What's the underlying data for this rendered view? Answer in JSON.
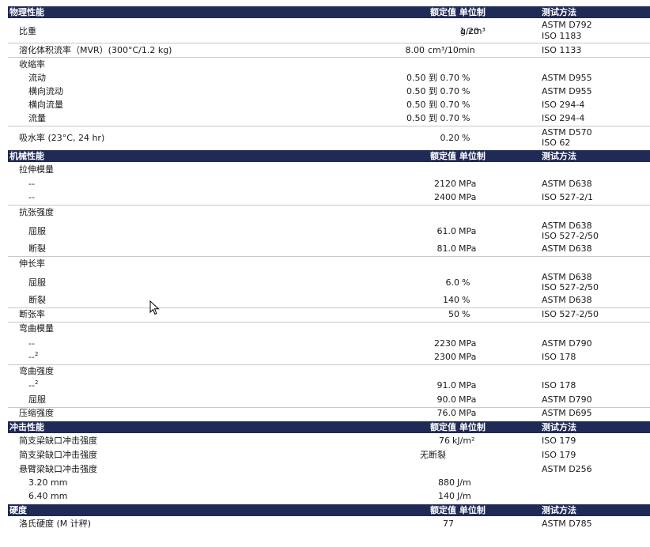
{
  "headers": {
    "value_unit": "额定值 单位制",
    "method": "测试方法"
  },
  "sections": {
    "physical": "物理性能",
    "mechanical": "机械性能",
    "impact": "冲击性能",
    "hardness": "硬度"
  },
  "physical": {
    "specific_gravity": {
      "label": "比重",
      "value": "1.20",
      "unit": "g/cm³",
      "m1": "ASTM D792",
      "m2": "ISO 1183"
    },
    "mvr": {
      "label": "溶化体积流率（MVR）(300°C/1.2 kg)",
      "value": "8.00",
      "unit": "cm³/10min",
      "m1": "ISO 1133"
    },
    "shrinkage": {
      "label": "收缩率"
    },
    "shrink_flow": {
      "label": "流动",
      "value": "0.50 到 0.70",
      "unit": "%",
      "m1": "ASTM D955"
    },
    "shrink_xflow": {
      "label": "横向流动",
      "value": "0.50 到 0.70",
      "unit": "%",
      "m1": "ASTM D955"
    },
    "shrink_xflow2": {
      "label": "横向流量",
      "value": "0.50 到 0.70",
      "unit": "%",
      "m1": "ISO 294-4"
    },
    "shrink_flow2": {
      "label": "流量",
      "value": "0.50 到 0.70",
      "unit": "%",
      "m1": "ISO 294-4"
    },
    "water_abs": {
      "label": "吸水率 (23°C, 24 hr)",
      "value": "0.20",
      "unit": "%",
      "m1": "ASTM D570",
      "m2": "ISO 62"
    }
  },
  "mechanical": {
    "tensile_modulus": {
      "label": "拉伸模量"
    },
    "tm1": {
      "label": "--",
      "value": "2120",
      "unit": "MPa",
      "m1": "ASTM D638"
    },
    "tm2": {
      "label": "--",
      "value": "2400",
      "unit": "MPa",
      "m1": "ISO 527-2/1"
    },
    "tensile_strength": {
      "label": "抗张强度"
    },
    "ts_yield": {
      "label": "屈服",
      "value": "61.0",
      "unit": "MPa",
      "m1": "ASTM D638",
      "m2": "ISO 527-2/50"
    },
    "ts_break": {
      "label": "断裂",
      "value": "81.0",
      "unit": "MPa",
      "m1": "ASTM D638"
    },
    "elongation": {
      "label": "伸长率"
    },
    "el_yield": {
      "label": "屈服",
      "value": "6.0",
      "unit": "%",
      "m1": "ASTM D638",
      "m2": "ISO 527-2/50"
    },
    "el_break": {
      "label": "断裂",
      "value": "140",
      "unit": "%",
      "m1": "ASTM D638"
    },
    "break_strain": {
      "label": "断张率",
      "value": "50",
      "unit": "%",
      "m1": "ISO 527-2/50"
    },
    "flex_modulus": {
      "label": "弯曲模量"
    },
    "fm1": {
      "label": "--",
      "value": "2230",
      "unit": "MPa",
      "m1": "ASTM D790"
    },
    "fm2": {
      "label": "--",
      "sup": "2",
      "value": "2300",
      "unit": "MPa",
      "m1": "ISO 178"
    },
    "flex_strength": {
      "label": "弯曲强度"
    },
    "fs1": {
      "label": "--",
      "sup": "2",
      "value": "91.0",
      "unit": "MPa",
      "m1": "ISO 178"
    },
    "fs_yield": {
      "label": "屈服",
      "value": "90.0",
      "unit": "MPa",
      "m1": "ASTM D790"
    },
    "compressive": {
      "label": "压缩强度",
      "value": "76.0",
      "unit": "MPa",
      "m1": "ASTM D695"
    }
  },
  "impact": {
    "charpy1": {
      "label": "简支梁缺口冲击强度",
      "value": "76",
      "unit": "kJ/m²",
      "m1": "ISO 179"
    },
    "charpy2": {
      "label": "简支梁缺口冲击强度",
      "value": "无断裂",
      "m1": "ISO 179"
    },
    "izod": {
      "label": "悬臂梁缺口冲击强度",
      "m1": "ASTM D256"
    },
    "izod1": {
      "label": "3.20 mm",
      "value": "880",
      "unit": "J/m"
    },
    "izod2": {
      "label": "6.40 mm",
      "value": "140",
      "unit": "J/m"
    }
  },
  "hardness": {
    "rockwell": {
      "label": "洛氏硬度 (M 计秤)",
      "value": "77",
      "m1": "ASTM D785"
    }
  }
}
